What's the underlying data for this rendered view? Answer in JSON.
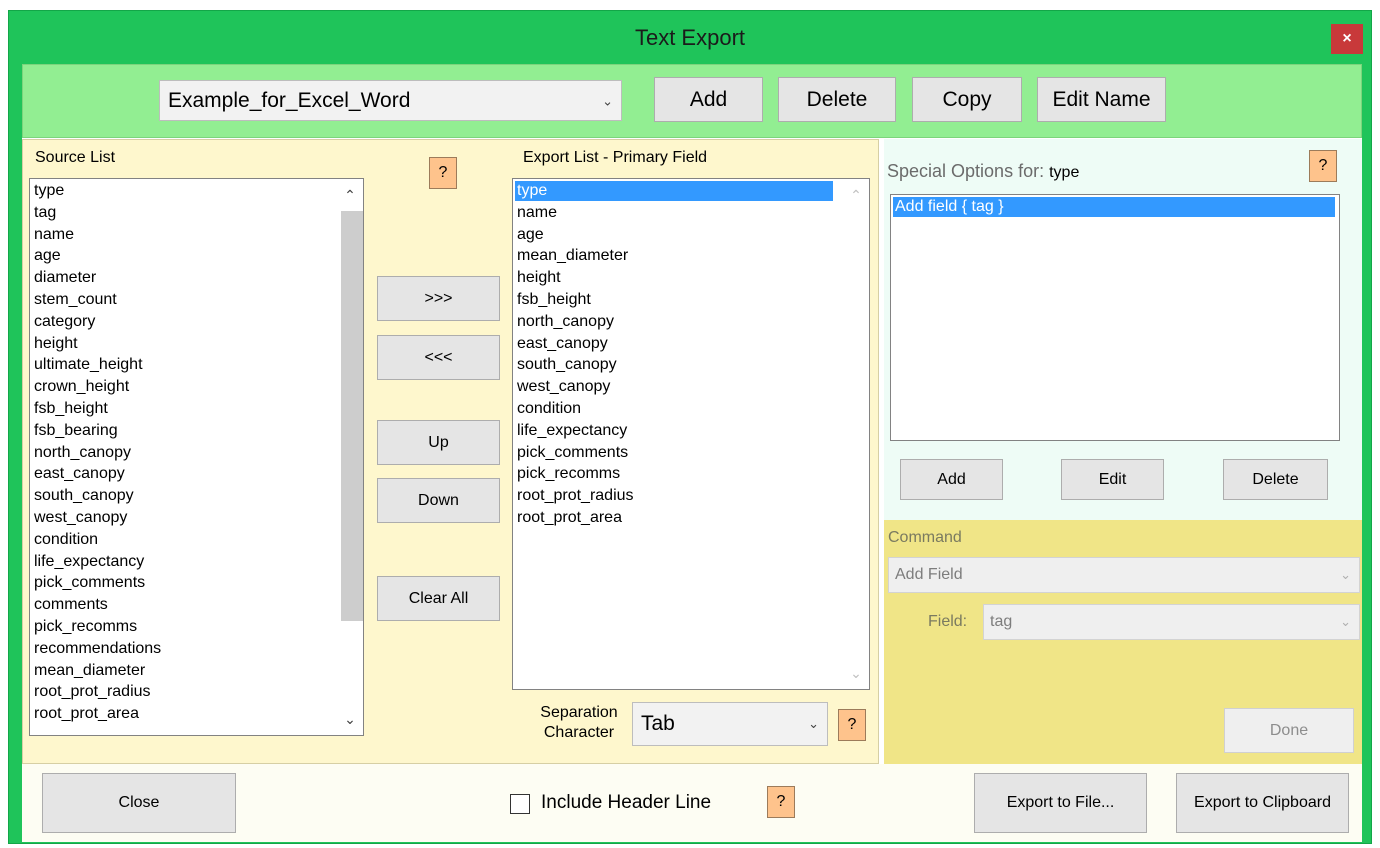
{
  "window": {
    "title": "Text Export",
    "close_glyph": "×"
  },
  "toolbar": {
    "preset_value": "Example_for_Excel_Word",
    "add_label": "Add",
    "delete_label": "Delete",
    "copy_label": "Copy",
    "edit_name_label": "Edit Name"
  },
  "source_list": {
    "label": "Source List",
    "items": [
      "type",
      "tag",
      "name",
      "age",
      "diameter",
      "stem_count",
      "category",
      "height",
      "ultimate_height",
      "crown_height",
      "fsb_height",
      "fsb_bearing",
      "north_canopy",
      "east_canopy",
      "south_canopy",
      "west_canopy",
      "condition",
      "life_expectancy",
      "pick_comments",
      "comments",
      "pick_recomms",
      "recommendations",
      "mean_diameter",
      "root_prot_radius",
      "root_prot_area"
    ]
  },
  "middle_buttons": {
    "help": "?",
    "move_right": ">>>",
    "move_left": "<<<",
    "up": "Up",
    "down": "Down",
    "clear_all": "Clear All"
  },
  "export_list": {
    "label": "Export List - Primary Field",
    "selected_index": 0,
    "items": [
      "type",
      "name",
      "age",
      "mean_diameter",
      "height",
      "fsb_height",
      "north_canopy",
      "east_canopy",
      "south_canopy",
      "west_canopy",
      "condition",
      "life_expectancy",
      "pick_comments",
      "pick_recomms",
      "root_prot_radius",
      "root_prot_area"
    ]
  },
  "separation": {
    "label_line1": "Separation",
    "label_line2": "Character",
    "value": "Tab",
    "help": "?"
  },
  "special_options": {
    "label": "Special Options for:",
    "field": "type",
    "help": "?",
    "items": [
      "Add field { tag }"
    ],
    "add_label": "Add",
    "edit_label": "Edit",
    "delete_label": "Delete"
  },
  "command": {
    "label": "Command",
    "value": "Add Field",
    "field_label": "Field:",
    "field_value": "tag",
    "done_label": "Done"
  },
  "footer": {
    "close_label": "Close",
    "include_header_label": "Include Header Line",
    "include_header_checked": false,
    "help": "?",
    "export_file_label": "Export to File...",
    "export_clipboard_label": "Export to Clipboard"
  },
  "colors": {
    "frame": "#1fc45a",
    "toolbar_bg": "#92ee92",
    "left_panel_bg": "#fef7cd",
    "special_bg": "#eefcf6",
    "command_bg": "#f0e587",
    "help_bg": "#fec38c",
    "selection": "#3399ff"
  }
}
